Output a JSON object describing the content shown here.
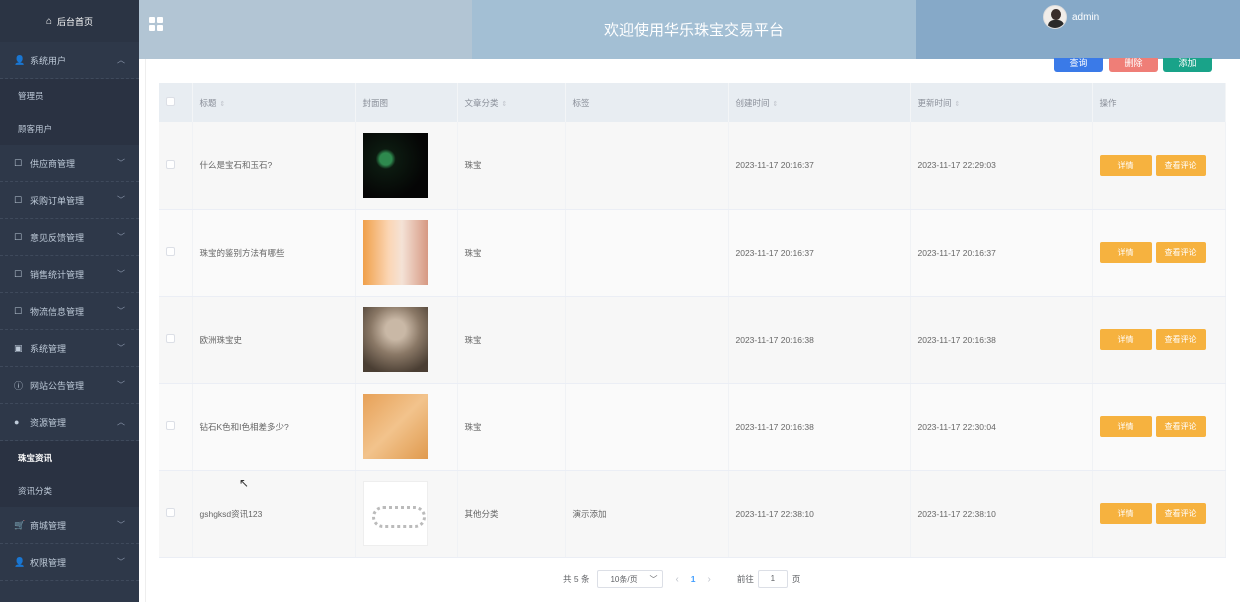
{
  "sidebar": {
    "home": "后台首页",
    "menus": [
      {
        "label": "系统用户",
        "icon": "user-icon",
        "expanded": true
      },
      {
        "label": "供应商管理",
        "icon": "doc-icon"
      },
      {
        "label": "采购订单管理",
        "icon": "doc-icon"
      },
      {
        "label": "意见反馈管理",
        "icon": "doc-icon"
      },
      {
        "label": "销售统计管理",
        "icon": "doc-icon"
      },
      {
        "label": "物流信息管理",
        "icon": "doc-icon"
      },
      {
        "label": "系统管理",
        "icon": "image-icon"
      },
      {
        "label": "网站公告管理",
        "icon": "info-icon"
      },
      {
        "label": "资源管理",
        "icon": "globe-icon",
        "expanded": true
      },
      {
        "label": "商城管理",
        "icon": "cart-icon"
      },
      {
        "label": "权限管理",
        "icon": "user-icon"
      }
    ],
    "sub_system_users": [
      "管理员",
      "顾客用户"
    ],
    "sub_resources": [
      "珠宝资讯",
      "资讯分类"
    ],
    "active": "珠宝资讯"
  },
  "header": {
    "title": "欢迎使用华乐珠宝交易平台",
    "username": "admin"
  },
  "toolbar": {
    "query": "查询",
    "delete": "删除",
    "add": "添加"
  },
  "table": {
    "columns": [
      "标题",
      "封面图",
      "文章分类",
      "标签",
      "创建时间",
      "更新时间",
      "操作"
    ],
    "rows": [
      {
        "title": "什么是宝石和玉石?",
        "category": "珠宝",
        "tag": "",
        "created": "2023-11-17 20:16:37",
        "updated": "2023-11-17 22:29:03"
      },
      {
        "title": "珠宝的鉴别方法有哪些",
        "category": "珠宝",
        "tag": "",
        "created": "2023-11-17 20:16:37",
        "updated": "2023-11-17 20:16:37"
      },
      {
        "title": "欧洲珠宝史",
        "category": "珠宝",
        "tag": "",
        "created": "2023-11-17 20:16:38",
        "updated": "2023-11-17 20:16:38"
      },
      {
        "title": "钻石K色和I色相差多少?",
        "category": "珠宝",
        "tag": "",
        "created": "2023-11-17 20:16:38",
        "updated": "2023-11-17 22:30:04"
      },
      {
        "title": "gshgksd资讯123",
        "category": "其他分类",
        "tag": "演示添加",
        "created": "2023-11-17 22:38:10",
        "updated": "2023-11-17 22:38:10"
      }
    ],
    "btn_detail": "详情",
    "btn_comments": "查看评论"
  },
  "pagination": {
    "total": "共 5 条",
    "page_size": "10条/页",
    "current": "1",
    "goto_prefix": "前往",
    "goto_value": "1",
    "goto_suffix": "页"
  }
}
